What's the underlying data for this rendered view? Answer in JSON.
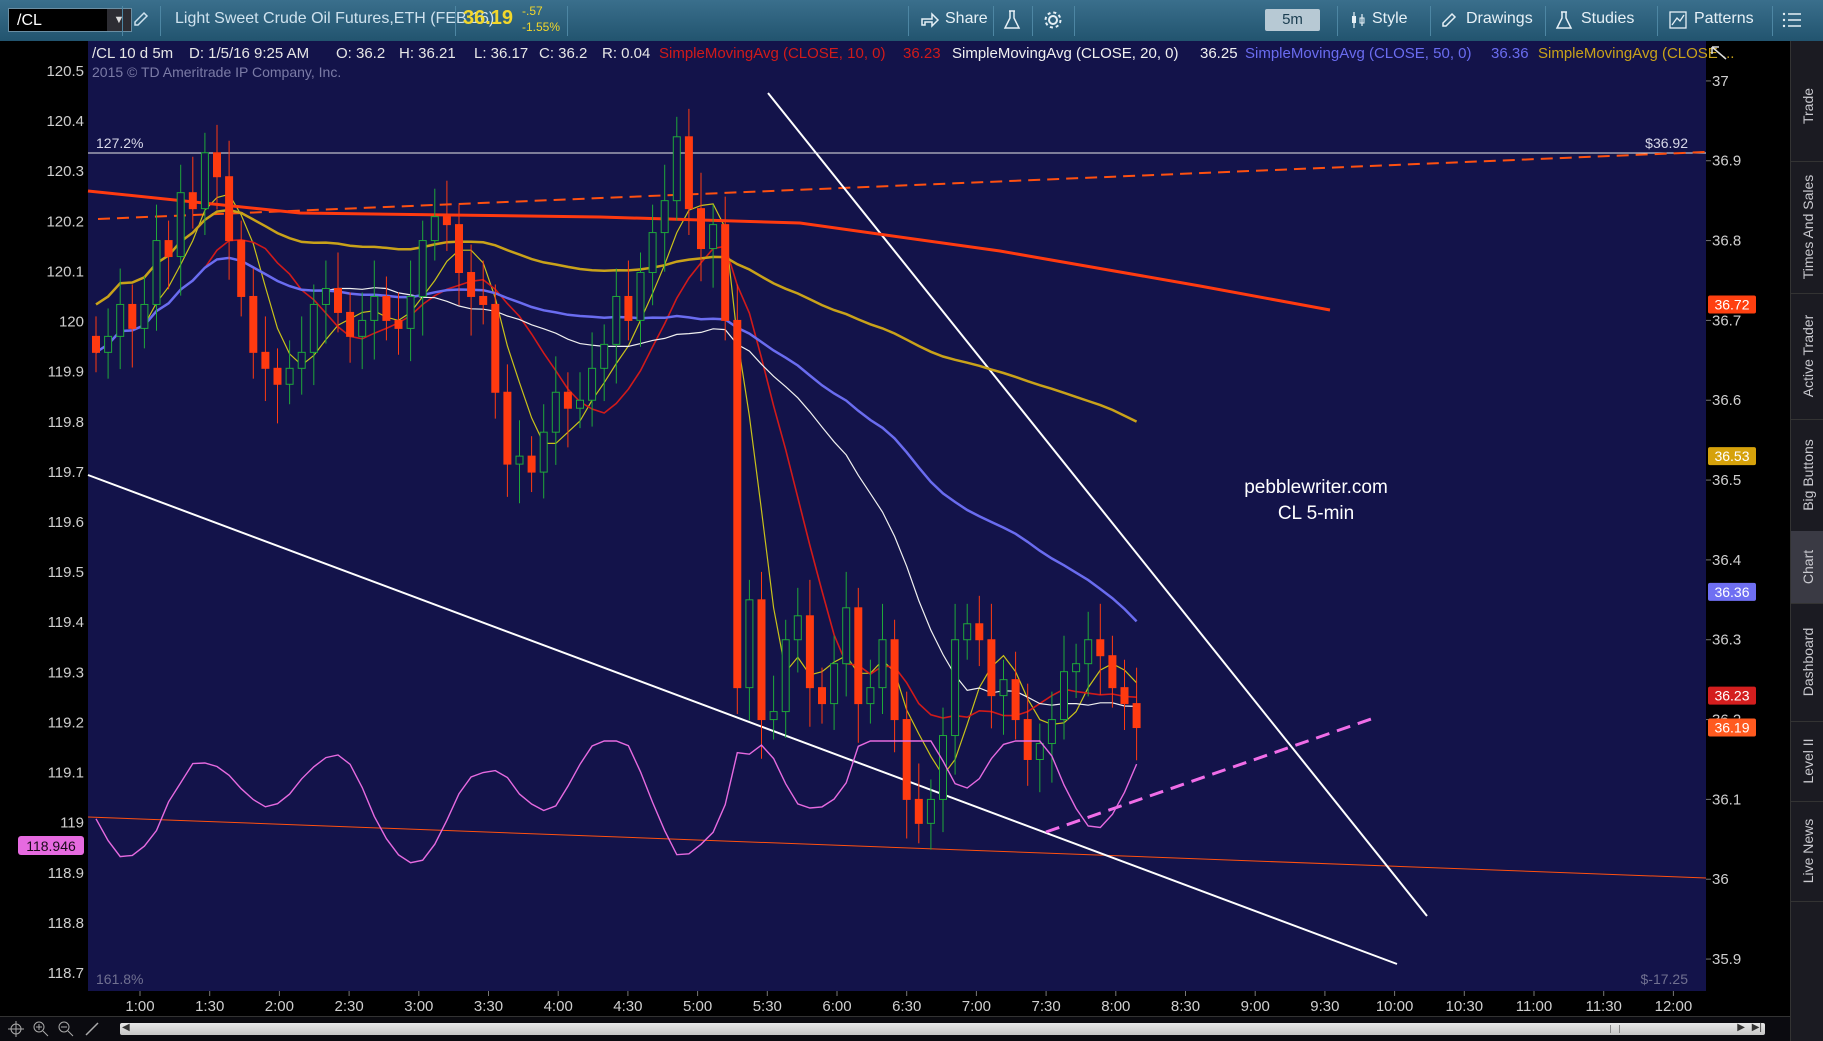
{
  "toolbar": {
    "symbol": "/CL",
    "description": "Light Sweet Crude Oil Futures,ETH (FEB 16)",
    "last_price": "36.19",
    "net_change": "-.57",
    "pct_change": "-1.55%",
    "share": "Share",
    "timeframe": "5m",
    "style": "Style",
    "drawings": "Drawings",
    "studies": "Studies",
    "patterns": "Patterns"
  },
  "header": {
    "symbol_period": "/CL 10 d 5m",
    "date": "D: 1/5/16 9:25 AM",
    "open": "O: 36.2",
    "high": "H: 36.21",
    "low": "L: 36.17",
    "close": "C: 36.2",
    "range": "R: 0.04",
    "sma10_label": "SimpleMovingAvg (CLOSE, 10, 0)",
    "sma10_value": "36.23",
    "sma20_label": "SimpleMovingAvg (CLOSE, 20, 0)",
    "sma20_value": "36.25",
    "sma50_label": "SimpleMovingAvg (CLOSE, 50, 0)",
    "sma50_value": "36.36",
    "sma200_label": "SimpleMovingAvg (CLOSE ..."
  },
  "copyright": "2015 © TD Ameritrade IP Company, Inc.",
  "right_tabs": [
    "Trade",
    "Times And Sales",
    "Active Trader",
    "Big Buttons",
    "Chart",
    "Dashboard",
    "Level II",
    "Live News"
  ],
  "chart_data": {
    "type": "candlestick",
    "x_ticks": [
      "1:00",
      "1:30",
      "2:00",
      "2:30",
      "3:00",
      "3:30",
      "4:00",
      "4:30",
      "5:00",
      "5:30",
      "6:00",
      "6:30",
      "7:00",
      "7:30",
      "8:00",
      "8:30",
      "9:00",
      "9:30",
      "10:00",
      "10:30",
      "11:00",
      "11:30",
      "12:00"
    ],
    "left_axis": {
      "ticks": [
        "120.5",
        "120.4",
        "120.3",
        "120.2",
        "120.1",
        "120",
        "119.9",
        "119.8",
        "119.7",
        "119.6",
        "119.5",
        "119.4",
        "119.3",
        "119.2",
        "119.1",
        "119",
        "118.9",
        "118.8",
        "118.7"
      ],
      "marker": "118.946",
      "marker_color": "#e66ae0"
    },
    "right_axis": {
      "ticks": [
        "37",
        "36.9",
        "36.8",
        "36.7",
        "36.6",
        "36.5",
        "36.4",
        "36.3",
        "36.2",
        "36.1",
        "36",
        "35.9"
      ],
      "ylim": [
        35.86,
        37.05
      ]
    },
    "price_markers": [
      {
        "label": "36.72",
        "color": "#ff4010"
      },
      {
        "label": "36.53",
        "color": "#d6a20b"
      },
      {
        "label": "36.36",
        "color": "#6f6ff2"
      },
      {
        "label": "36.23",
        "color": "#d41e1e"
      },
      {
        "label": "36.19",
        "color": "#ff5a1f"
      }
    ],
    "fib_labels": {
      "top_left": "127.2%",
      "top_right": "$36.92",
      "bottom_left": "161.8%",
      "bottom_right": "$-17.25"
    },
    "watermark": [
      "pebblewriter.com",
      "CL 5-min"
    ],
    "series": [
      {
        "name": "SimpleMovingAvg (CLOSE, 10, 0)",
        "color": "#d11a1a"
      },
      {
        "name": "SimpleMovingAvg (CLOSE, 20, 0)",
        "color": "#f0f0f0"
      },
      {
        "name": "SimpleMovingAvg (CLOSE, 50, 0)",
        "color": "#6a6cf0"
      },
      {
        "name": "SimpleMovingAvg (CLOSE ...",
        "color": "#c9a21a"
      }
    ],
    "candles_close": [
      36.66,
      36.68,
      36.72,
      36.69,
      36.72,
      36.8,
      36.78,
      36.86,
      36.84,
      36.91,
      36.88,
      36.8,
      36.73,
      36.66,
      36.64,
      36.62,
      36.64,
      36.66,
      36.72,
      36.74,
      36.71,
      36.68,
      36.7,
      36.73,
      36.7,
      36.69,
      36.73,
      36.8,
      36.83,
      36.82,
      36.76,
      36.73,
      36.72,
      36.61,
      36.52,
      36.53,
      36.51,
      36.56,
      36.61,
      36.59,
      36.6,
      36.64,
      36.67,
      36.73,
      36.7,
      36.76,
      36.81,
      36.85,
      36.93,
      36.84,
      36.79,
      36.82,
      36.7,
      36.24,
      36.35,
      36.2,
      36.21,
      36.3,
      36.33,
      36.24,
      36.22,
      36.27,
      36.34,
      36.22,
      36.24,
      36.3,
      36.2,
      36.1,
      36.07,
      36.1,
      36.18,
      36.3,
      36.32,
      36.3,
      36.23,
      36.25,
      36.2,
      36.15,
      36.17,
      36.2,
      36.26,
      36.27,
      36.3,
      36.28,
      36.24,
      36.22,
      36.19
    ]
  }
}
